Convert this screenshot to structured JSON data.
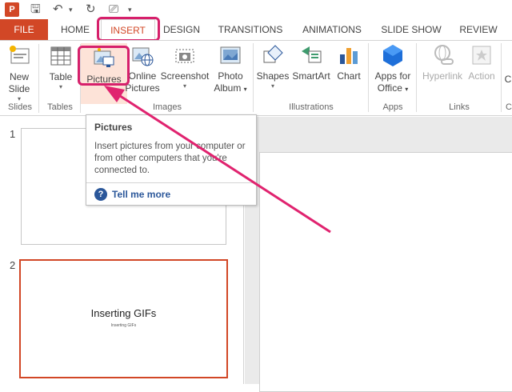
{
  "qat": {
    "app_icon": "powerpoint-icon",
    "buttons": [
      {
        "name": "save-icon",
        "glyph": "🖫"
      },
      {
        "name": "undo-icon",
        "glyph": "↶"
      },
      {
        "name": "dropdown-icon",
        "glyph": "▾"
      },
      {
        "name": "redo-icon",
        "glyph": "↻"
      },
      {
        "name": "start-from-beginning-icon",
        "glyph": "⎚"
      },
      {
        "name": "customize-qat-icon",
        "glyph": "▾"
      }
    ]
  },
  "tabs": {
    "file": "FILE",
    "home": "HOME",
    "insert": "INSERT",
    "design": "DESIGN",
    "transitions": "TRANSITIONS",
    "animations": "ANIMATIONS",
    "slide_show": "SLIDE SHOW",
    "review": "REVIEW"
  },
  "ribbon": {
    "new_slide": {
      "line1": "New",
      "line2": "Slide"
    },
    "table": {
      "label": "Table"
    },
    "pictures": {
      "label": "Pictures"
    },
    "online_pictures": {
      "line1": "Online",
      "line2": "Pictures"
    },
    "screenshot": {
      "label": "Screenshot"
    },
    "photo_album": {
      "line1": "Photo",
      "line2": "Album"
    },
    "shapes": {
      "label": "Shapes"
    },
    "smartart": {
      "label": "SmartArt"
    },
    "chart": {
      "label": "Chart"
    },
    "apps_for_office": {
      "line1": "Apps for",
      "line2": "Office"
    },
    "hyperlink": {
      "label": "Hyperlink"
    },
    "action": {
      "label": "Action"
    },
    "cut_off_next": "C",
    "groups": {
      "slides": "Slides",
      "tables": "Tables",
      "images": "Images",
      "illustrations": "Illustrations",
      "apps": "Apps",
      "links": "Links",
      "cut_off": "C"
    }
  },
  "tooltip": {
    "title": "Pictures",
    "body": "Insert pictures from your computer or from other computers that you're connected to.",
    "help_link": "Tell me more"
  },
  "thumbnails": [
    {
      "number": "1",
      "title": "",
      "subtitle": ""
    },
    {
      "number": "2",
      "title": "Inserting GIFs",
      "subtitle": "Inserting GIFs"
    }
  ],
  "colors": {
    "accent": "#d24726",
    "highlight": "#d6206b",
    "link": "#2b579a"
  }
}
